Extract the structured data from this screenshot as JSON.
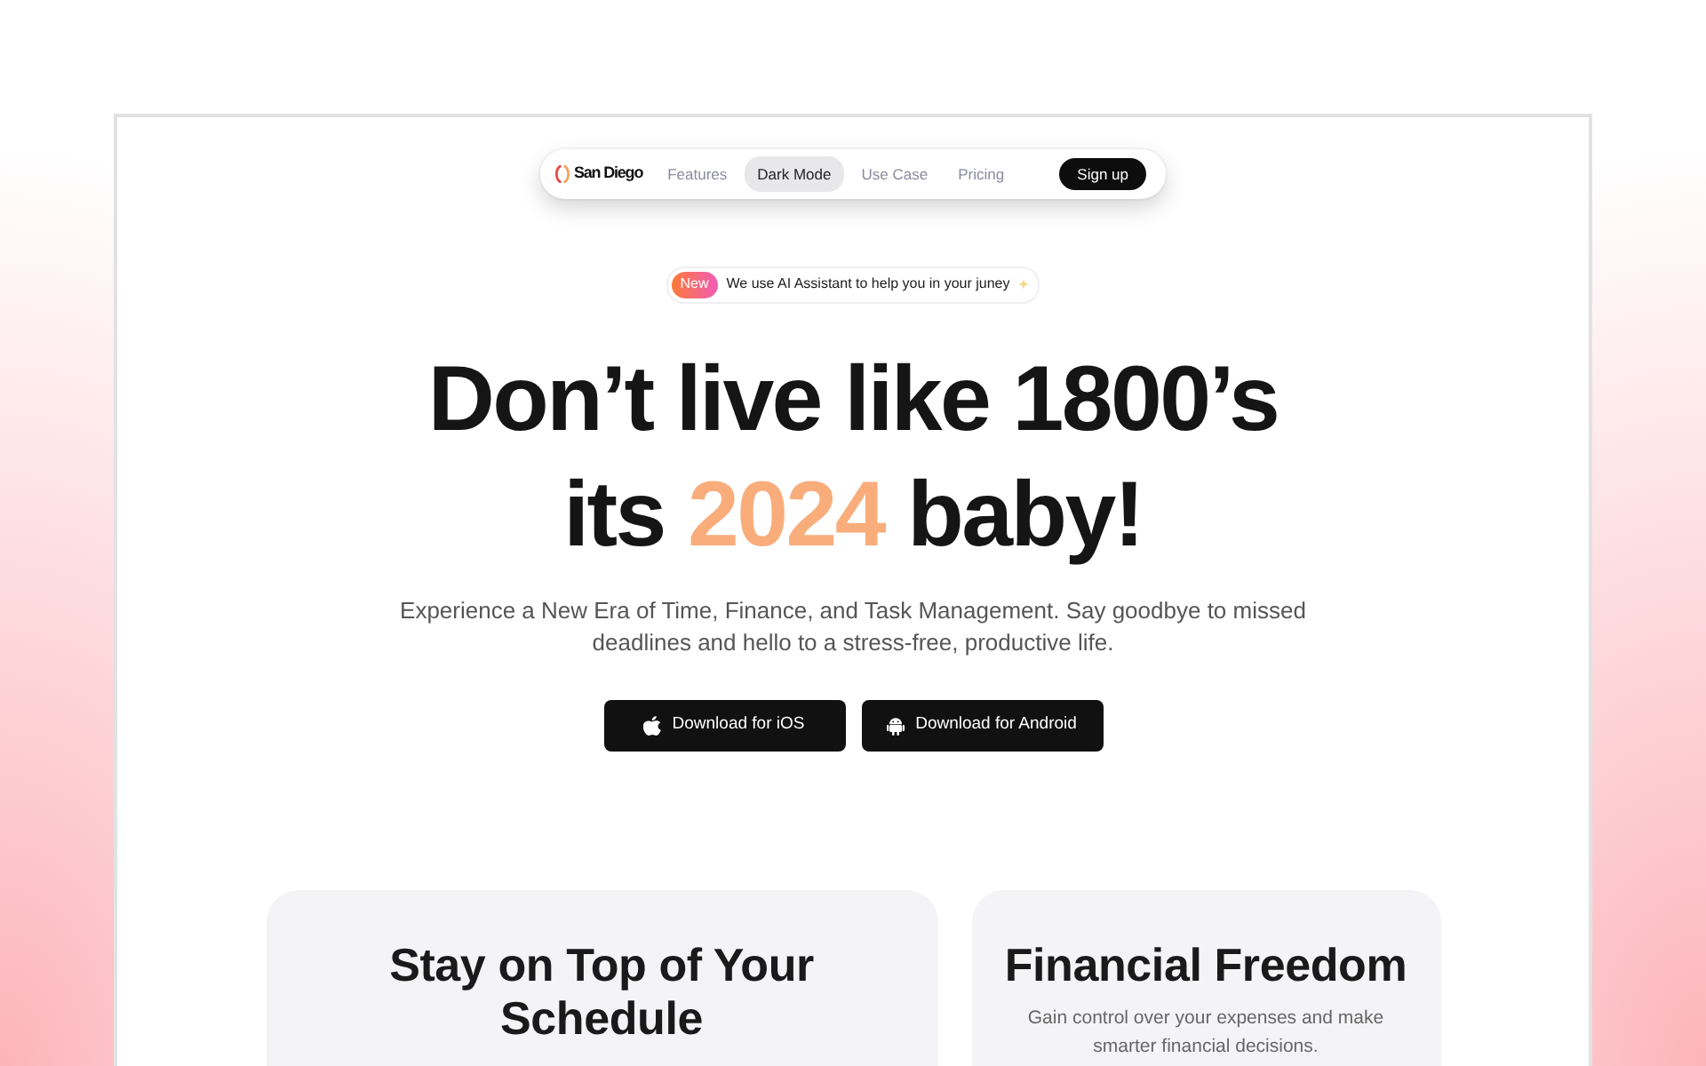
{
  "nav": {
    "brand": "San Diego",
    "links": [
      {
        "label": "Features",
        "selected": false
      },
      {
        "label": "Dark Mode",
        "selected": true
      },
      {
        "label": "Use Case",
        "selected": false
      },
      {
        "label": "Pricing",
        "selected": false
      }
    ],
    "cta": "Sign up"
  },
  "announcement": {
    "tag": "New",
    "text": "We use AI Assistant to help you in your juney"
  },
  "headline": {
    "lines": [
      [
        {
          "text": "Don’t live like 1800’s",
          "highlight": false
        }
      ],
      [
        {
          "text": "its ",
          "highlight": false
        },
        {
          "text": "2024",
          "highlight": true
        },
        {
          "text": " baby!",
          "highlight": false
        }
      ]
    ]
  },
  "subtitle": "Experience a New Era of Time, Finance, and Task Management. Say goodbye to missed deadlines and hello to a stress-free, productive life.",
  "downloads": [
    {
      "kind": "ios",
      "label": "Download for iOS"
    },
    {
      "kind": "android",
      "label": "Download for Android"
    }
  ],
  "features": [
    {
      "title": "Stay on Top of Your Schedule"
    },
    {
      "title": "Financial Freedom",
      "description": "Gain control over your expenses and make smarter financial decisions."
    }
  ]
}
